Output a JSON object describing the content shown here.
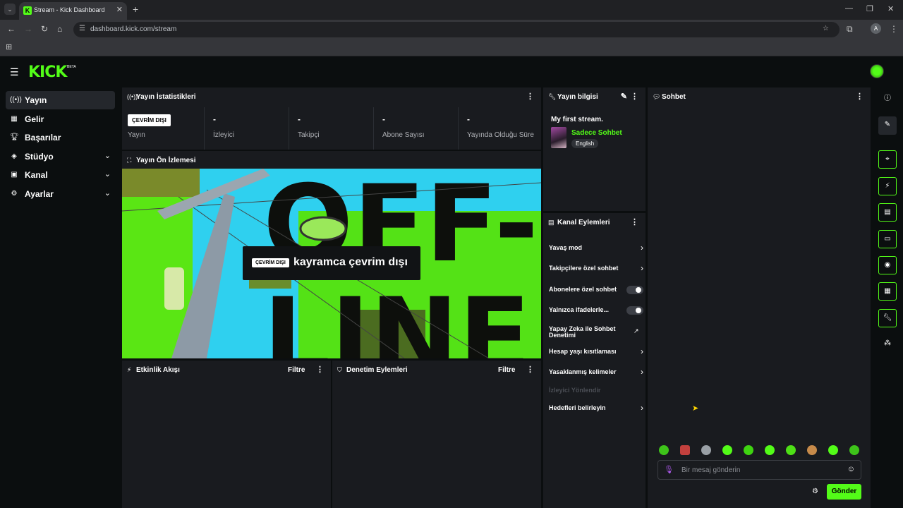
{
  "browser": {
    "tab_title": "Stream - Kick Dashboard",
    "url": "dashboard.kick.com/stream",
    "profile_initial": "A"
  },
  "app": {
    "logo": "KICK",
    "logo_badge": "BETA",
    "accent_color": "#53fc18"
  },
  "sidebar": {
    "items": [
      {
        "label": "Yayın",
        "icon": "broadcast-icon"
      },
      {
        "label": "Gelir",
        "icon": "revenue-icon"
      },
      {
        "label": "Başarılar",
        "icon": "trophy-icon"
      },
      {
        "label": "Stüdyo",
        "icon": "studio-icon"
      },
      {
        "label": "Kanal",
        "icon": "channel-icon"
      },
      {
        "label": "Ayarlar",
        "icon": "gear-icon"
      }
    ]
  },
  "stats": {
    "title": "Yayın İstatistikleri",
    "offline_badge": "ÇEVRİM DIŞI",
    "items": [
      {
        "value": "",
        "label": "Yayın"
      },
      {
        "value": "-",
        "label": "İzleyici"
      },
      {
        "value": "-",
        "label": "Takipçi"
      },
      {
        "value": "-",
        "label": "Abone Sayısı"
      },
      {
        "value": "-",
        "label": "Yayında Olduğu Süre"
      }
    ]
  },
  "preview": {
    "title": "Yayın Ön İzlemesi",
    "offline_badge": "ÇEVRİM DIŞI",
    "message": "kayramca çevrim dışı",
    "bg_text_1": "OFF-",
    "bg_text_2": "LINE"
  },
  "activity": {
    "title": "Etkinlik Akışı",
    "filter": "Filtre"
  },
  "moderation": {
    "title": "Denetim Eylemleri",
    "filter": "Filtre"
  },
  "stream_info": {
    "title": "Yayın bilgisi",
    "stream_title": "My first stream.",
    "category": "Sadece Sohbet",
    "language": "English"
  },
  "channel_actions": {
    "title": "Kanal Eylemleri",
    "items": [
      {
        "label": "Yavaş mod",
        "control": "chevron"
      },
      {
        "label": "Takipçilere özel sohbet",
        "control": "chevron"
      },
      {
        "label": "Abonelere özel sohbet",
        "control": "toggle",
        "on": false
      },
      {
        "label": "Yalnızca ifadelerle...",
        "control": "toggle",
        "on": false
      },
      {
        "label": "Yapay Zeka ile Sohbet Denetimi",
        "control": "external"
      },
      {
        "label": "Hesap yaşı kısıtlaması",
        "control": "chevron"
      },
      {
        "label": "Yasaklanmış kelimeler",
        "control": "chevron"
      },
      {
        "label": "İzleyici Yönlendir",
        "control": "none",
        "disabled": true
      },
      {
        "label": "Hedefleri belirleyin",
        "control": "chevron"
      }
    ]
  },
  "chat": {
    "title": "Sohbet",
    "placeholder": "Bir mesaj gönderin",
    "send_label": "Gönder",
    "emotes": [
      "emote-1",
      "emote-2",
      "emote-3",
      "emote-4",
      "emote-5",
      "emote-6",
      "emote-7",
      "emote-8",
      "emote-9",
      "emote-10"
    ]
  },
  "rail": {
    "items": [
      "info-icon",
      "pencil-icon",
      "screenshot-icon",
      "lightning-icon",
      "document-icon",
      "chat-icon",
      "broadcast-icon",
      "layout-icon",
      "wrench-icon",
      "share-icon"
    ]
  }
}
